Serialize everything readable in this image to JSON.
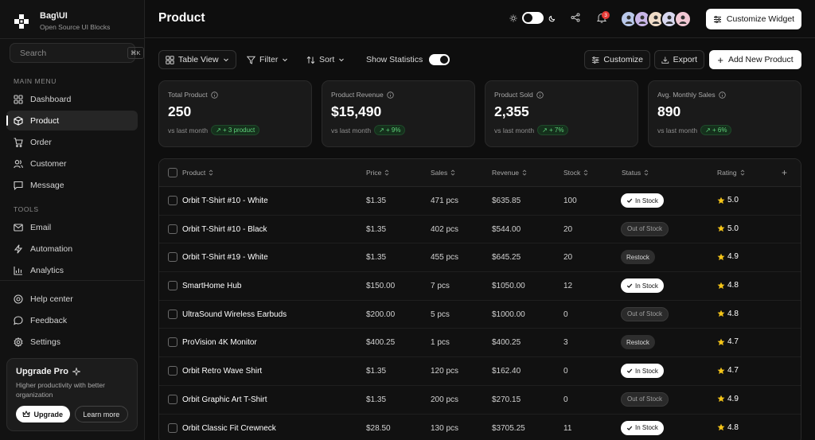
{
  "brand": {
    "name": "Bag\\UI",
    "sub": "Open Source UI Blocks"
  },
  "search": {
    "placeholder": "Search",
    "shortcut": "⌘K"
  },
  "sidebar": {
    "main_label": "MAIN MENU",
    "main_items": [
      {
        "label": "Dashboard",
        "icon": "grid-icon"
      },
      {
        "label": "Product",
        "icon": "box-icon",
        "active": true
      },
      {
        "label": "Order",
        "icon": "cart-icon"
      },
      {
        "label": "Customer",
        "icon": "users-icon"
      },
      {
        "label": "Message",
        "icon": "message-icon"
      }
    ],
    "tools_label": "TOOLS",
    "tools_items": [
      {
        "label": "Email",
        "icon": "mail-icon"
      },
      {
        "label": "Automation",
        "icon": "bolt-icon"
      },
      {
        "label": "Analytics",
        "icon": "chart-icon"
      }
    ],
    "bottom_items": [
      {
        "label": "Help center",
        "icon": "help-icon"
      },
      {
        "label": "Feedback",
        "icon": "feedback-icon"
      },
      {
        "label": "Settings",
        "icon": "gear-icon"
      }
    ]
  },
  "upgrade": {
    "title": "Upgrade Pro",
    "desc": "Higher productivity with better organization",
    "upgrade_label": "Upgrade",
    "learn_label": "Learn more"
  },
  "header": {
    "title": "Product",
    "notification_count": "3",
    "customize_widget_label": "Customize Widget"
  },
  "toolbar": {
    "view_label": "Table View",
    "filter_label": "Filter",
    "sort_label": "Sort",
    "stats_label": "Show Statistics",
    "customize_label": "Customize",
    "export_label": "Export",
    "add_label": "Add New Product"
  },
  "stats": [
    {
      "label": "Total Product",
      "value": "250",
      "compare": "vs last month",
      "trend": "+ 3 product"
    },
    {
      "label": "Product Revenue",
      "value": "$15,490",
      "compare": "vs last month",
      "trend": "+ 9%"
    },
    {
      "label": "Product Sold",
      "value": "2,355",
      "compare": "vs last month",
      "trend": "+ 7%"
    },
    {
      "label": "Avg. Monthly Sales",
      "value": "890",
      "compare": "vs last month",
      "trend": "+ 6%"
    }
  ],
  "table": {
    "columns": {
      "product": "Product",
      "price": "Price",
      "sales": "Sales",
      "revenue": "Revenue",
      "stock": "Stock",
      "status": "Status",
      "rating": "Rating"
    },
    "rows": [
      {
        "name": "Orbit T-Shirt #10 - White",
        "price": "$1.35",
        "sales": "471 pcs",
        "revenue": "$635.85",
        "stock": "100",
        "status": "In Stock",
        "rating": "5.0"
      },
      {
        "name": "Orbit T-Shirt #10 - Black",
        "price": "$1.35",
        "sales": "402 pcs",
        "revenue": "$544.00",
        "stock": "20",
        "status": "Out of Stock",
        "rating": "5.0"
      },
      {
        "name": "Orbit T-Shirt #19 - White",
        "price": "$1.35",
        "sales": "455 pcs",
        "revenue": "$645.25",
        "stock": "20",
        "status": "Restock",
        "rating": "4.9"
      },
      {
        "name": "SmartHome Hub",
        "price": "$150.00",
        "sales": "7 pcs",
        "revenue": "$1050.00",
        "stock": "12",
        "status": "In Stock",
        "rating": "4.8"
      },
      {
        "name": "UltraSound Wireless Earbuds",
        "price": "$200.00",
        "sales": "5 pcs",
        "revenue": "$1000.00",
        "stock": "0",
        "status": "Out of Stock",
        "rating": "4.8"
      },
      {
        "name": "ProVision 4K Monitor",
        "price": "$400.25",
        "sales": "1 pcs",
        "revenue": "$400.25",
        "stock": "3",
        "status": "Restock",
        "rating": "4.7"
      },
      {
        "name": "Orbit Retro Wave Shirt",
        "price": "$1.35",
        "sales": "120 pcs",
        "revenue": "$162.40",
        "stock": "0",
        "status": "In Stock",
        "rating": "4.7"
      },
      {
        "name": "Orbit Graphic Art T-Shirt",
        "price": "$1.35",
        "sales": "200 pcs",
        "revenue": "$270.15",
        "stock": "0",
        "status": "Out of Stock",
        "rating": "4.9"
      },
      {
        "name": "Orbit Classic Fit Crewneck",
        "price": "$28.50",
        "sales": "130 pcs",
        "revenue": "$3705.25",
        "stock": "11",
        "status": "In Stock",
        "rating": "4.8"
      }
    ]
  },
  "colors": {
    "background": "#0e0e0e",
    "accent": "#ffffff",
    "trend_green": "#5fd17a",
    "star": "#f5c518",
    "badge_red": "#e53935"
  }
}
